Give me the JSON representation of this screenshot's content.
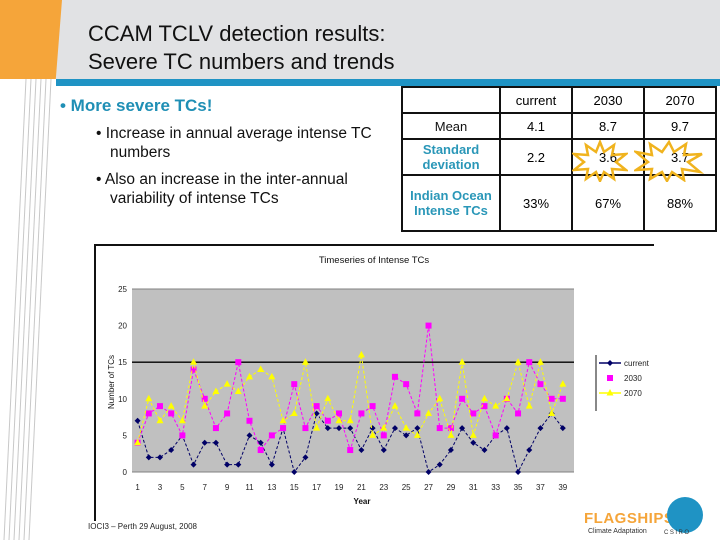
{
  "slide": {
    "title_line1": "CCAM TCLV detection results:",
    "title_line2": "Severe TC numbers and trends",
    "bullet_main": "• More severe TCs!",
    "sub_bullets": [
      "• Increase in annual average intense TC numbers",
      "• Also an increase in the inter-annual variability of intense TCs"
    ],
    "footer": "IOCI3 – Perth 29 August, 2008",
    "logo_text": "FLAGSHIPS",
    "logo_subtext": "Climate Adaptation",
    "org_text": "CSIRO"
  },
  "table": {
    "headers": [
      "",
      "current",
      "2030",
      "2070"
    ],
    "rows": [
      {
        "label": "Mean",
        "values": [
          "4.1",
          "8.7",
          "9.7"
        ]
      },
      {
        "label": "Standard deviation",
        "values": [
          "2.2",
          "3.6",
          "3.7"
        ]
      },
      {
        "label": "Indian Ocean Intense TCs",
        "values": [
          "33%",
          "67%",
          "88%"
        ]
      }
    ],
    "highlight_color": "#f0b31e"
  },
  "chart_data": {
    "type": "line",
    "title": "Timeseries of Intense TCs",
    "xlabel": "Year",
    "ylabel": "Number of TCs",
    "ylim": [
      0,
      25
    ],
    "yticks": [
      0,
      5,
      10,
      15,
      20,
      25
    ],
    "xticks": [
      1,
      3,
      5,
      7,
      9,
      11,
      13,
      15,
      17,
      19,
      21,
      23,
      25,
      27,
      29,
      31,
      33,
      35,
      37,
      39
    ],
    "x": [
      1,
      2,
      3,
      4,
      5,
      6,
      7,
      8,
      9,
      10,
      11,
      12,
      13,
      14,
      15,
      16,
      17,
      18,
      19,
      20,
      21,
      22,
      23,
      24,
      25,
      26,
      27,
      28,
      29,
      30,
      31,
      32,
      33,
      34,
      35,
      36,
      37,
      38,
      39
    ],
    "reference_line": 15,
    "legend_position": "right",
    "series": [
      {
        "name": "current",
        "color": "#000066",
        "marker": "diamond",
        "values": [
          7,
          2,
          2,
          3,
          5,
          1,
          4,
          4,
          1,
          1,
          5,
          4,
          1,
          6,
          0,
          2,
          8,
          6,
          6,
          6,
          3,
          6,
          3,
          6,
          5,
          6,
          0,
          1,
          3,
          6,
          4,
          3,
          5,
          6,
          0,
          3,
          6,
          8,
          6
        ]
      },
      {
        "name": "2030",
        "color": "#ff00ff",
        "marker": "square",
        "values": [
          4,
          8,
          9,
          8,
          5,
          14,
          10,
          6,
          8,
          15,
          7,
          3,
          5,
          6,
          12,
          6,
          9,
          7,
          8,
          3,
          8,
          9,
          5,
          13,
          12,
          8,
          20,
          6,
          6,
          10,
          8,
          9,
          5,
          10,
          8,
          15,
          12,
          10,
          10
        ]
      },
      {
        "name": "2070",
        "color": "#ffff00",
        "marker": "triangle",
        "values": [
          4,
          10,
          7,
          9,
          7,
          15,
          9,
          11,
          12,
          11,
          13,
          14,
          13,
          7,
          8,
          15,
          6,
          10,
          7,
          7,
          16,
          5,
          6,
          9,
          6,
          5,
          8,
          10,
          5,
          15,
          5,
          10,
          9,
          10,
          15,
          9,
          15,
          8,
          12
        ]
      }
    ]
  }
}
